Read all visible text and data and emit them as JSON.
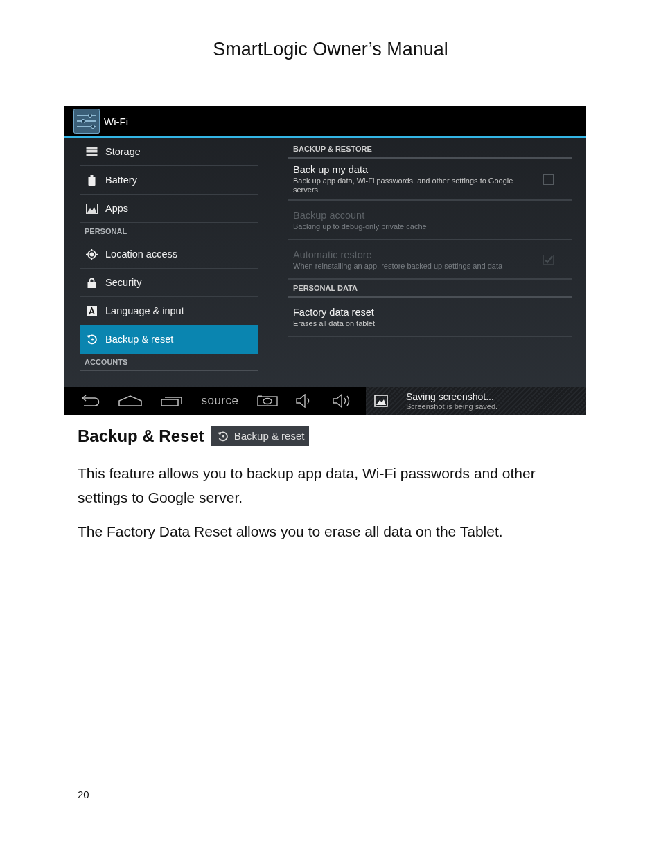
{
  "page_title": "SmartLogic Owner’s Manual",
  "screenshot": {
    "action_bar": {
      "title": "Wi-Fi"
    },
    "sidebar": {
      "items": [
        {
          "kind": "item",
          "label": "Storage",
          "selected": false
        },
        {
          "kind": "item",
          "label": "Battery",
          "selected": false
        },
        {
          "kind": "item",
          "label": "Apps",
          "selected": false
        },
        {
          "kind": "header",
          "label": "PERSONAL"
        },
        {
          "kind": "item",
          "label": "Location access",
          "selected": false
        },
        {
          "kind": "item",
          "label": "Security",
          "selected": false
        },
        {
          "kind": "item",
          "label": "Language & input",
          "selected": false
        },
        {
          "kind": "item",
          "label": "Backup & reset",
          "selected": true
        },
        {
          "kind": "header",
          "label": "ACCOUNTS"
        }
      ]
    },
    "detail": {
      "items": [
        {
          "kind": "header",
          "label": "BACKUP & RESTORE"
        },
        {
          "kind": "pref",
          "title": "Back up my data",
          "summary": "Back up app data, Wi-Fi passwords, and other settings to Google servers",
          "disabled": false,
          "checked": false
        },
        {
          "kind": "pref",
          "title": "Backup account",
          "summary": "Backing up to debug-only private cache",
          "disabled": true
        },
        {
          "kind": "pref",
          "title": "Automatic restore",
          "summary": "When reinstalling an app, restore backed up settings and data",
          "disabled": true,
          "checked": true
        },
        {
          "kind": "header",
          "label": "PERSONAL DATA"
        },
        {
          "kind": "pref",
          "title": "Factory data reset",
          "summary": "Erases all data on tablet",
          "disabled": false
        }
      ]
    },
    "nav_bar": {
      "label": "source",
      "notification": {
        "title": "Saving screenshot...",
        "text": "Screenshot is being saved."
      }
    }
  },
  "section": {
    "heading": "Backup & Reset",
    "badge": "Backup & reset"
  },
  "paragraphs": [
    " This feature allows you to backup app data, Wi-Fi passwords and other settings to Google server.",
    "The Factory Data Reset allows you to erase all data on the Tablet."
  ],
  "page_number": "20"
}
